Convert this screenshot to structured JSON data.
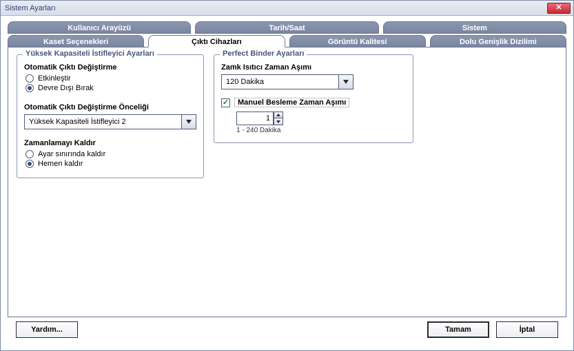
{
  "window": {
    "title": "Sistem Ayarları"
  },
  "tabs_top": {
    "ui": "Kullanıcı Arayüzü",
    "datetime": "Tarih/Saat",
    "system": "Sistem"
  },
  "tabs_bottom": {
    "tray": "Kaset Seçenekleri",
    "output": "Çıktı Cihazları",
    "image": "Görüntü Kalitesi",
    "full": "Dolu Genişlik Dizilimi"
  },
  "stacker": {
    "group": "Yüksek Kapasiteli İstifleyici Ayarları",
    "auto_switch_label": "Otomatik Çıktı Değiştirme",
    "enable": "Etkinleştir",
    "disable": "Devre Dışı Bırak",
    "priority_label": "Otomatik Çıktı Değiştirme Önceliği",
    "priority_value": "Yüksek Kapasiteli İstifleyici 2",
    "unload_label": "Zamanlamayı Kaldır",
    "unload_limit": "Ayar sınırında kaldır",
    "unload_now": "Hemen kaldır"
  },
  "binder": {
    "group": "Perfect Binder Ayarları",
    "heater_label": "Zamk Isıtıcı Zaman Aşımı",
    "heater_value": "120 Dakika",
    "manual_label": "Manuel Besleme Zaman Aşımı",
    "manual_value": "1",
    "manual_hint": "1 - 240 Dakika"
  },
  "footer": {
    "help": "Yardım...",
    "ok": "Tamam",
    "cancel": "İptal"
  }
}
